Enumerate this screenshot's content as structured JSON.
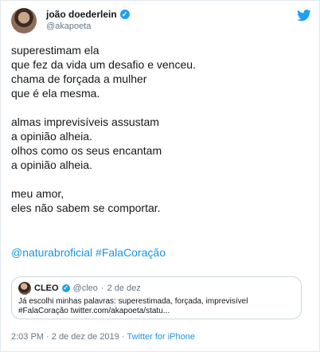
{
  "tweet": {
    "author_name": "joão doederlein",
    "author_handle": "@akapoeta",
    "lines": [
      "superestimam ela",
      "que fez da vida um desafio e venceu.",
      "chama de forçada a mulher",
      "que é ela mesma.",
      "almas imprevisíveis assustam",
      "a opinião alheia.",
      "olhos como os seus encantam",
      "a opinião alheia.",
      "meu amor,",
      "eles não sabem se comportar."
    ],
    "hashtags": "@naturabroficial #FalaCoração",
    "quote": {
      "name": "CLEO",
      "handle": "@cleo",
      "date": "2 de dez",
      "line1": "Já escolhi minhas palavras: superestimada, forçada, imprevisível",
      "line2": "#FalaCoração twitter.com/akapoeta/statu..."
    },
    "footer": {
      "time": "2:03 PM",
      "date": "2 de dez de 2019",
      "source": "Twitter for iPhone"
    }
  },
  "icons": {
    "bird": "twitter-bird-icon",
    "verified": "verified-badge-icon"
  },
  "colors": {
    "accent": "#1b95e0",
    "verified": "#1da1f2",
    "text": "#14171a",
    "muted": "#657786"
  }
}
